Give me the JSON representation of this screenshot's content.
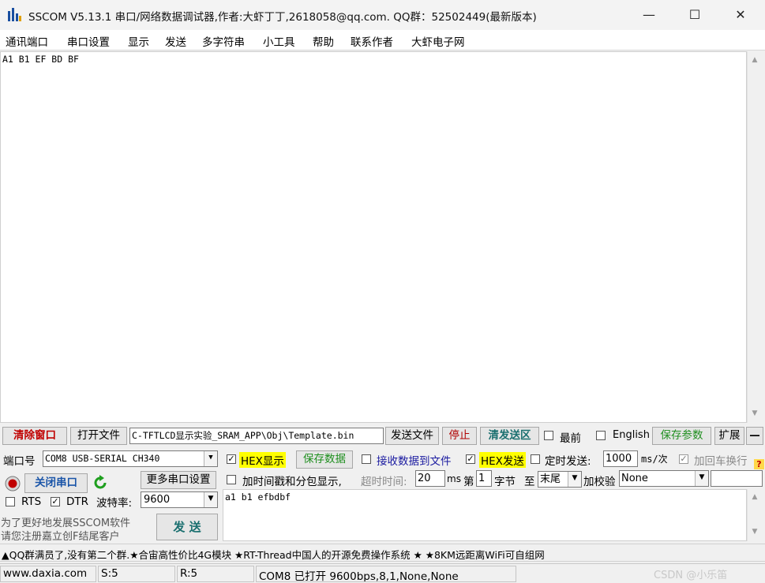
{
  "title_bar": {
    "app_icon": "sscom-bar-logo-icon",
    "title": "SSCOM V5.13.1 串口/网络数据调试器,作者:大虾丁丁,2618058@qq.com. QQ群：52502449(最新版本)",
    "minimize": "—",
    "maximize": "☐",
    "close": "✕"
  },
  "menu": {
    "items": [
      "通讯端口",
      "串口设置",
      "显示",
      "发送",
      "多字符串",
      "小工具",
      "帮助",
      "联系作者",
      "大虾电子网"
    ]
  },
  "receive": {
    "text": "A1 B1 EF BD BF"
  },
  "toolbar": {
    "clear_window": "清除窗口",
    "open_file": "打开文件",
    "file_path": "C-TFTLCD显示实验_SRAM_APP\\Obj\\Template.bin",
    "send_file": "发送文件",
    "stop": "停止",
    "clear_send": "清发送区",
    "topmost": "最前",
    "english": "English",
    "save_params": "保存参数",
    "expand": "扩展",
    "collapse": "—"
  },
  "port": {
    "label": "端口号",
    "value": "COM8 USB-SERIAL CH340",
    "close_port": "关闭串口",
    "more_settings": "更多串口设置",
    "rts": "RTS",
    "dtr": "DTR",
    "baud_label": "波特率:",
    "baud_value": "9600",
    "promo": [
      "为了更好地发展SSCOM软件",
      "请您注册嘉立创F结尾客户"
    ],
    "send": "发  送",
    "status_color": "#c00000",
    "refresh_color": "#1f9f1f"
  },
  "options": {
    "hex_display": "HEX显示",
    "hex_display_checked": true,
    "save_data": "保存数据",
    "recv_to_file": "接收数据到文件",
    "recv_to_file_checked": false,
    "hex_send": "HEX发送",
    "hex_send_checked": true,
    "timed_send": "定时发送:",
    "timed_send_checked": false,
    "interval_value": "1000",
    "interval_unit": "ms/次",
    "add_crlf": "加回车换行",
    "add_crlf_checked": true,
    "timestamp_split": "加时间戳和分包显示,",
    "timestamp_split_checked": false,
    "timeout_label": "超时时间:",
    "timeout_value": "20",
    "timeout_unit": "ms",
    "byte_prefix": "第",
    "byte_value": "1",
    "byte_suffix": "字节",
    "to_label": "至",
    "end_value": "末尾",
    "checksum_label": "加校验",
    "checksum_value": "None",
    "highlight_color": "#ffff00"
  },
  "send_area": {
    "text": "a1 b1 efbdbf"
  },
  "ticker": {
    "text": "▲QQ群满员了,没有第二个群.★合宙高性价比4G模块 ★RT-Thread中国人的开源免费操作系统 ★ ★8KM远距离WiFi可自组网"
  },
  "status_bar": {
    "website": "www.daxia.com",
    "sent": "S:5",
    "received": "R:5",
    "port_status": "COM8 已打开  9600bps,8,1,None,None",
    "watermark": "CSDN @小乐笛"
  }
}
